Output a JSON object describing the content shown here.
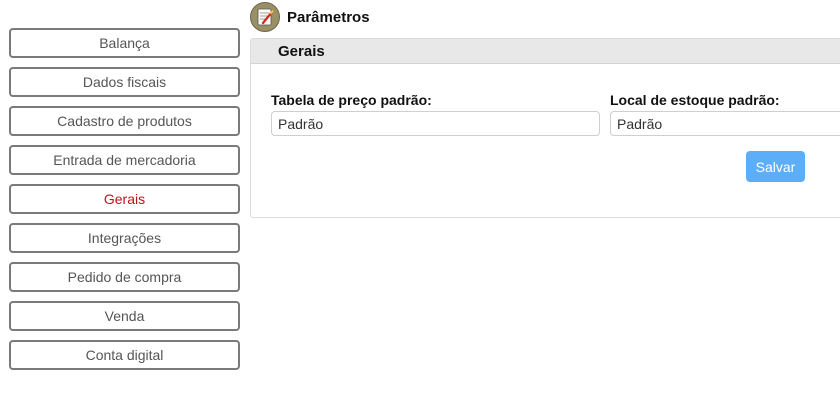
{
  "header": {
    "title": "Parâmetros",
    "icon": "settings-document-icon"
  },
  "sidebar": {
    "items": [
      {
        "label": "Balança",
        "active": false
      },
      {
        "label": "Dados fiscais",
        "active": false
      },
      {
        "label": "Cadastro de produtos",
        "active": false
      },
      {
        "label": "Entrada de mercadoria",
        "active": false
      },
      {
        "label": "Gerais",
        "active": true
      },
      {
        "label": "Integrações",
        "active": false
      },
      {
        "label": "Pedido de compra",
        "active": false
      },
      {
        "label": "Venda",
        "active": false
      },
      {
        "label": "Conta digital",
        "active": false
      }
    ]
  },
  "panel": {
    "title": "Gerais",
    "fields": {
      "price_table": {
        "label": "Tabela de preço padrão:",
        "value": "Padrão"
      },
      "stock_location": {
        "label": "Local de estoque padrão:",
        "value": "Padrão"
      }
    },
    "save_label": "Salvar"
  },
  "colors": {
    "active_item": "#c0111b",
    "save_button": "#5baef7",
    "panel_header": "#e8e8e8"
  }
}
